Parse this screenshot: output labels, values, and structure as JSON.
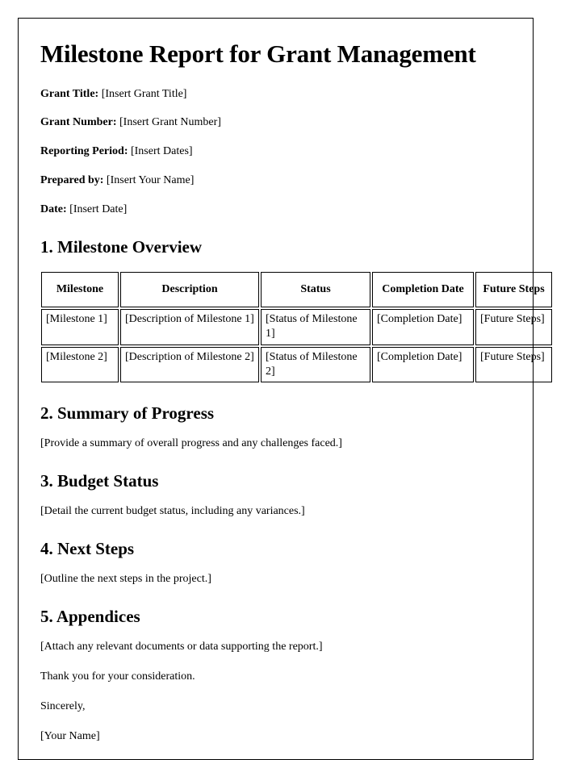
{
  "document": {
    "title": "Milestone Report for Grant Management",
    "meta": [
      {
        "label": "Grant Title:",
        "value": "[Insert Grant Title]"
      },
      {
        "label": "Grant Number:",
        "value": "[Insert Grant Number]"
      },
      {
        "label": "Reporting Period:",
        "value": "[Insert Dates]"
      },
      {
        "label": "Prepared by:",
        "value": "[Insert Your Name]"
      },
      {
        "label": "Date:",
        "value": "[Insert Date]"
      }
    ],
    "sections": [
      {
        "heading": "1. Milestone Overview",
        "body": ""
      },
      {
        "heading": "2. Summary of Progress",
        "body": "[Provide a summary of overall progress and any challenges faced.]"
      },
      {
        "heading": "3. Budget Status",
        "body": "[Detail the current budget status, including any variances.]"
      },
      {
        "heading": "4. Next Steps",
        "body": "[Outline the next steps in the project.]"
      },
      {
        "heading": "5. Appendices",
        "body": "[Attach any relevant documents or data supporting the report.]"
      }
    ],
    "table": {
      "headers": [
        "Milestone",
        "Description",
        "Status",
        "Completion Date",
        "Future Steps"
      ],
      "rows": [
        {
          "milestone": "[Milestone 1]",
          "description": "[Description of Milestone 1]",
          "status": "[Status of Milestone 1]",
          "completion": "[Completion Date]",
          "future": "[Future Steps]"
        },
        {
          "milestone": "[Milestone 2]",
          "description": "[Description of Milestone 2]",
          "status": "[Status of Milestone 2]",
          "completion": "[Completion Date]",
          "future": "[Future Steps]"
        }
      ]
    },
    "closing": {
      "thanks": "Thank you for your consideration.",
      "salutation": "Sincerely,",
      "signature": "[Your Name]"
    }
  }
}
